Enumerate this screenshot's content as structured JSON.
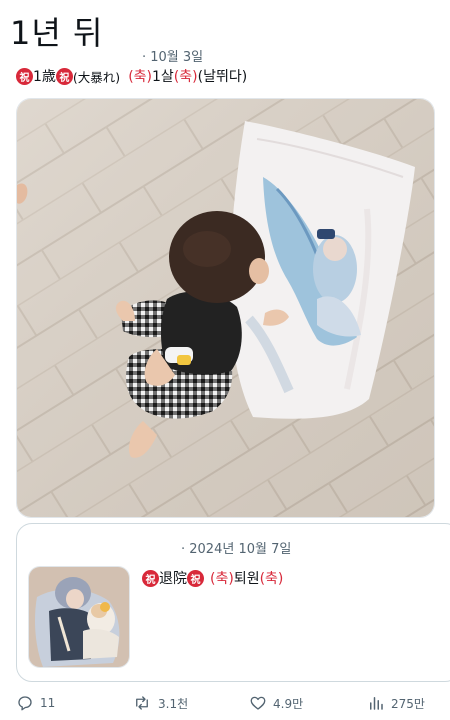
{
  "heading": "1년 뒤",
  "post": {
    "date": "· 10월 3일",
    "caption": {
      "iwai_badge": "祝",
      "age_jp": "1歳",
      "note_jp": "(大暴れ)",
      "chuk_open": "(축)",
      "age_kr": "1살",
      "chuk_close": "(축)",
      "note_kr": "(날뛰다)"
    }
  },
  "quote": {
    "date": "· 2024년 10월 7일",
    "caption": {
      "iwai_badge": "祝",
      "discharge_jp": "退院",
      "chuk_open": "(축)",
      "discharge_kr": "퇴원",
      "chuk_close": "(축)"
    }
  },
  "actions": {
    "replies": "11",
    "reposts": "3.1천",
    "likes": "4.9만",
    "views": "275만"
  }
}
